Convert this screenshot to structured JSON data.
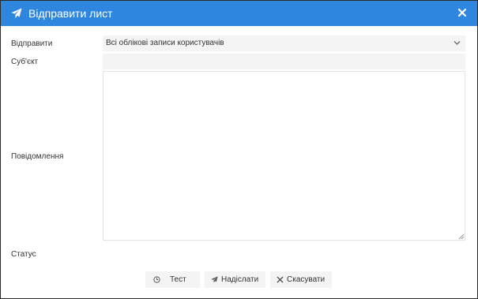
{
  "dialog": {
    "title": "Відправити лист",
    "title_icon": "paper-plane-icon",
    "close_icon": "close-icon"
  },
  "form": {
    "send_to_label": "Відправити",
    "send_to_value": "Всі облікові записи користувачів",
    "subject_label": "Суб'єкт",
    "subject_value": "",
    "message_label": "Повідомлення",
    "message_value": "",
    "status_label": "Статус"
  },
  "buttons": {
    "test": {
      "label": "Тест",
      "icon": "clock-icon"
    },
    "send": {
      "label": "Надіслати",
      "icon": "paper-plane-icon"
    },
    "cancel": {
      "label": "Скасувати",
      "icon": "close-icon"
    }
  },
  "colors": {
    "titlebar": "#2e86de",
    "field_background": "#f4f4f4"
  }
}
